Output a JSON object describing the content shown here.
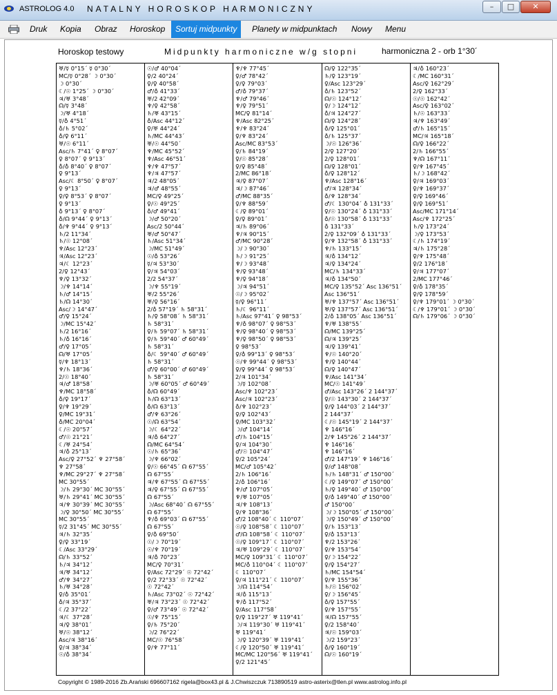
{
  "window": {
    "title": "ASTROLOG 4.0",
    "heading": "NATALNY HOROSKOP HARMONICZNY",
    "controls": {
      "minimize": "–",
      "maximize": "□",
      "close": "✕"
    }
  },
  "menu": [
    {
      "label": "Druk",
      "active": false
    },
    {
      "label": "Kopia",
      "active": false
    },
    {
      "label": "Obraz",
      "active": false
    },
    {
      "label": "Horoskop",
      "active": false
    },
    {
      "label": "Sortuj midpunkty",
      "active": true
    },
    {
      "label": "Planety w midpunktach",
      "active": false
    },
    {
      "label": "Nowy",
      "active": false
    },
    {
      "label": "Menu",
      "active": false
    }
  ],
  "header": {
    "chart_name": "Horoskop testowy",
    "title": "Midpunkty harmoniczne w/g stopni",
    "harmonic": "harmoniczna 2 - orb 1°30´"
  },
  "columns": [
    [
      "♅/☿ 0°15´ ☿ 0°30´",
      "MC/☿ 0°28´ ☽ 0°30´",
      "☽ 0°30´",
      "☾/☉ 1°25´ ☽ 0°30´",
      "♃/♅ 3°48´",
      "☊/☿ 3°48´",
      "☽/♅ 4°18´",
      "☿/♁ 4°51´",
      "♁/♄ 5°02´",
      "♁/♀ 6°11´",
      "♅/☉ 6°11´",
      "Asc/♄ 7°41´ ♀ 8°07´",
      "♀ 8°07´ ♀ 9°13´",
      "♁/♁ 8°40´ ♀ 8°07´",
      "♀ 9°13´",
      "Asc/☾ 8°50´ ♀ 8°07´",
      "♀ 9°13´",
      "♀/♀ 8°53´ ♀ 8°07´",
      "♀ 9°13´",
      "♁ 9°13´ ♀ 8°07´",
      "♁/☊ 9°44´ ♀ 9°13´",
      "♁/♆ 9°44´ ♀ 9°13´",
      "♄/2 11°34´",
      "♄/☉ 12°08´",
      "♆/Asc 12°23´",
      "♃/Asc 12°23´",
      "♃/☾ 12°23´",
      "2/♀ 12°43´",
      "♆/♀ 13°32´",
      "☽/♆ 14°14´",
      "♄/♂ 14°15´",
      "♄/☊ 14°30´",
      "Asc/☽ 14°47´",
      "♂/♀ 15°24´",
      "☽/MC 15°42´",
      "♄/2 16°16´",
      "♄/♁ 16°16´",
      "♂/♀ 17°05´",
      "☊/♅ 17°05´",
      "☿/♆ 18°13´",
      "♆/♄ 18°36´",
      "2/☉ 18°40´",
      "♃/♂ 18°58´",
      "♆/MC 18°58´",
      "♁/♀ 19°17´",
      "♀/♆ 19°29´",
      "♀/MC 19°31´",
      "♁/MC 20°04´",
      "☾/☉ 20°57´",
      "♂/☉ 21°21´",
      "☾/♅ 24°54´",
      "♃/♁ 25°13´",
      "Asc/♀ 27°52´ ♆ 27°58´",
      "♆ 27°58´",
      "♆/MC 29°27´ ♆ 27°58´",
      "MC 30°55´",
      "☽/♄ 29°30´ MC 30°55´",
      "♅/♄ 29°41´ MC 30°55´",
      "♃/♆ 30°39´ MC 30°55´",
      "☽/♀ 30°50´ MC 30°55´",
      "MC 30°55´",
      "☿/2 31°45´ MC 30°55´",
      "♃/♄ 32°35´",
      "♀/♀ 33°19´",
      "☾/Asc 33°29´",
      "☊/♄ 33°52´",
      "♄/♃ 34°12´",
      "♃/♅ 34°12´",
      "♂/♆ 34°27´",
      "♄/♅ 34°28´",
      "♀/♁ 35°01´",
      "♁/♃ 35°37´",
      "☾/2 37°22´",
      "♃/☾ 37°28´",
      "♃/♀ 38°01´",
      "♅/☉ 38°12´",
      "Asc/♃ 38°16´",
      "♀/♃ 38°34´",
      "☉/♁ 38°34´"
    ],
    [
      "☉/♂ 40°04´",
      "♀/2 40°24´",
      "♀/♀ 40°58´",
      "♂/♁ 41°33´",
      "♅/2 42°09´",
      "♆/♀ 42°58´",
      "♄/♅ 43°15´",
      "♁/Asc 44°12´",
      "♀/♅ 44°24´",
      "♄/MC 44°43´",
      "♅/☉ 44°50´",
      "♆/MC 45°52´",
      "♆/Asc 46°51´",
      "♆/♆ 47°57´",
      "♆/♃ 47°57´",
      "♃/2 48°05´",
      "♃/♂ 48°55´",
      "MC/♀ 49°25´",
      "♀/☉ 49°25´",
      "♁/♂ 49°41´",
      "☽/♂ 50°20´",
      "Asc/2 50°44´",
      "♅/♂ 50°47´",
      "♄/Asc 51°34´",
      "☽/MC 51°49´",
      "☉/♁ 53°26´",
      "☿/♃ 53°30´",
      "♀/♃ 54°03´",
      "2/2 54°37´",
      "☽/♆ 55°19´",
      "♅/2 55°26´",
      "♅/♀ 56°16´",
      "2/♁ 57°19´ ♄ 58°31´",
      "♄/♀ 58°08´ ♄ 58°31´",
      "♄ 58°31´",
      "♀/♄ 59°07´ ♄ 58°31´",
      "♀/♄ 59°40´ ♂ 60°49´",
      "♄ 58°31´",
      "♁/☾ 59°40´ ♂ 60°49´",
      "♄ 58°31´",
      "♂/♀ 60°00´ ♂ 60°49´",
      "♄ 58°31´",
      "☽/♅ 60°05´ ♂ 60°49´",
      "♁/☊ 60°49´",
      "♄/☊ 63°13´",
      "♁/☊ 63°13´",
      "♂/♆ 63°26´",
      "☉/☊ 63°54´",
      "☽/☾ 64°22´",
      "♃/♁ 64°27´",
      "☊/MC 64°54´",
      "☉/♄ 65°36´",
      "☽/♆ 66°02´",
      "♀/☉ 66°45´ ☊ 67°55´",
      "☊ 67°55´",
      "♃/♆ 67°55´ ☊ 67°55´",
      "♃/♀ 67°55´ ☊ 67°55´",
      "☊ 67°55´",
      "☽/Asc 68°40´ ☊ 67°55´",
      "☊ 67°55´",
      "♆/♁ 69°03´ ☊ 67°55´",
      "☊ 67°55´",
      "♀/♁ 69°50´",
      "☉/☽ 70°19´",
      "☉/♆ 70°19´",
      "♃/♁ 70°23´",
      "MC/♀ 70°31´",
      "♀/Asc 72°29´ ☉ 72°42´",
      "♀/2 72°33´ ☉ 72°42´",
      "☉ 72°42´",
      "♄/Asc 73°02´ ☉ 72°42´",
      "♅/♃ 73°23´ ☉ 72°42´",
      "♀/♂ 73°49´ ☉ 72°42´",
      "☉/♆ 75°15´",
      "♀/♄ 75°20´",
      "☽/2 76°22´",
      "MC/☉ 76°58´",
      "♀/♆ 77°11´"
    ],
    [
      "♆/♆ 77°45´",
      "♀/♂ 78°42´",
      "♀/♀ 79°03´",
      "♂/♁ 79°37´",
      "♆/♂ 79°46´",
      "♆/♀ 79°51´",
      "MC/♀ 81°14´",
      "♆/Asc 82°25´",
      "♆/♆ 83°24´",
      "♀/♆ 83°24´",
      "Asc/MC 83°53´",
      "♀/♄ 84°19´",
      "♀/☉ 85°28´",
      "♀/♀ 85°48´",
      "2/MC 86°18´",
      "♃/♀ 87°07´",
      "♃/☽ 87°46´",
      "♂/MC 88°35´",
      "♀/♆ 88°59´",
      "☾/♀ 89°01´",
      "♀/♀ 89°01´",
      "♃/♄ 89°06´",
      "♆/♃ 90°15´",
      "♂/MC 90°28´",
      "☽/☽ 90°30´",
      "♄/☽ 91°25´",
      "♆/☽ 93°48´",
      "♆/♀ 93°48´",
      "♆/♀ 94°18´",
      "☽/♃ 94°51´",
      "☉/☽ 95°02´",
      "☿/♀ 96°11´",
      "♄/☾ 96°11´",
      "♄/Asc 97°41´ ♀ 98°53´",
      "♆/♁ 98°07´ ♀ 98°53´",
      "♆/♀ 98°40´ ♀ 98°53´",
      "♆/♀ 98°50´ ♀ 98°53´",
      "♀ 98°53´",
      "♀/♁ 99°13´ ♀ 98°53´",
      "☉/♆ 99°44´ ♀ 98°53´",
      "♀/♀ 99°44´ ♀ 98°53´",
      "2/♃ 101°34´",
      "☽/☿ 102°08´",
      "Asc/♆ 102°23´",
      "Asc/♃ 102°23´",
      "♁/♆ 102°23´",
      "♀/♀ 102°43´",
      "♀/MC 103°32´",
      "☽/♂ 104°14´",
      "♂/♄ 104°15´",
      "♀/♃ 104°30´",
      "♂/☉ 104°47´",
      "♀/2 105°24´",
      "MC/♂ 105°42´",
      "2/♄ 106°16´",
      "2/♁ 106°16´",
      "♆/♂ 107°05´",
      "♆/♅ 107°05´",
      "♃/♆ 108°13´",
      "♀/♆ 108°36´",
      "♂/2 108°40´ ☾ 110°07´",
      "☉/♀ 108°58´ ☾ 110°07´",
      "♂/☊ 108°58´ ☾ 110°07´",
      "☉/♀ 109°17´ ☾ 110°07´",
      "♃/♅ 109°29´ ☾ 110°07´",
      "MC/♀ 109°31´ ☾ 110°07´",
      "MC/♁ 110°04´ ☾ 110°07´",
      "☾ 110°07´",
      "♀/♃ 111°21´ ☾ 110°07´",
      "☽/☊ 114°54´",
      "♃/♁ 115°13´",
      "♆/♁ 117°52´",
      "♀/Asc 117°58´",
      "♀/♀ 119°27´ ♅ 119°41´",
      "☽/♃ 119°30´ ♅ 119°41´",
      "♅ 119°41´",
      "☽/♀ 120°39´ ♅ 119°41´",
      "☾/♀ 120°50´ ♅ 119°41´",
      "MC/MC 120°56´ ♅ 119°41´",
      "♀/2 121°45´"
    ],
    [
      "☊/♀ 122°35´",
      "♄/♀ 123°19´",
      "♀/Asc 123°29´",
      "♁/♄ 123°52´",
      "☊/☉ 124°12´",
      "♀/☽ 124°12´",
      "♁/♃ 124°27´",
      "☊/♀ 124°28´",
      "♁/♀ 125°01´",
      "♁/♄ 125°37´",
      "☽/☉ 126°36´",
      "2/♀ 127°20´",
      "2/♀ 128°01´",
      "☊/♀ 128°01´",
      "♁/♀ 128°12´",
      "♆/Asc 128°16´",
      "♂/♃ 128°34´",
      "♁/♆ 128°34´",
      "♂/☾ 130°04´ ♁ 131°33´",
      "♀/☉ 130°24´ ♁ 131°33´",
      "♁/☉ 130°58´ ♁ 131°33´",
      "♁ 131°33´",
      "2/♀ 132°09´ ♁ 131°33´",
      "♀/♆ 132°58´ ♁ 131°33´",
      "♆/♄ 133°15´",
      "♃/♁ 134°12´",
      "♃/♀ 134°24´",
      "MC/♄ 134°33´",
      "♃/♁ 134°50´",
      "MC/♀ 135°52´ Asc 136°51´",
      "Asc 136°51´",
      "♅/♆ 137°57´ Asc 136°51´",
      "♅/♀ 137°57´ Asc 136°51´",
      "2/♁ 138°05´ Asc 136°51´",
      "♆/♅ 138°55´",
      "☊/MC 139°25´",
      "☊/♃ 139°25´",
      "♃/♀ 139°41´",
      "♆/☉ 140°20´",
      "♆/♀ 140°44´",
      "☊/♀ 140°47´",
      "♆/Asc 141°34´",
      "MC/☉ 141°49´",
      "♂/Asc 143°26´ 2 144°37´",
      "♀/☉ 143°30´ 2 144°37´",
      "♀/♀ 144°03´ 2 144°37´",
      "2 144°37´",
      "☾/☉ 145°19´ 2 144°37´",
      "♆ 146°16´",
      "2/♆ 145°26´ 2 144°37´",
      "♆ 146°16´",
      "♆ 146°16´",
      "♂/2 147°19´ ♆ 146°16´",
      "♀/♂ 148°08´",
      "♄/♄ 148°31´ ♂ 150°00´",
      "☾/♀ 149°07´ ♂ 150°00´",
      "♄/♀ 149°40´ ♂ 150°00´",
      "♀/♁ 149°40´ ♂ 150°00´",
      "♂ 150°00´",
      "☽/☽ 150°05´ ♂ 150°00´",
      "☽/♀ 150°49´ ♂ 150°00´",
      "♀/♄ 153°13´",
      "♀/♁ 153°13´",
      "♆/2 153°26´",
      "♀/♆ 153°54´",
      "♀/☽ 154°22´",
      "♀/♀ 154°27´",
      "♄/MC 154°54´",
      "♀/♆ 155°36´",
      "♄/☉ 156°02´",
      "♀/☽ 156°45´",
      "♁/♀ 157°55´",
      "♀/♆ 157°55´",
      "♃/☊ 157°55´",
      "♀/2 158°40´",
      "♃/☉ 159°03´",
      "☽/2 159°23´",
      "♁/♀ 160°19´",
      "☊/☉ 160°19´"
    ],
    [
      "♃/♁ 160°23´",
      "☾/MC 160°31´",
      "Asc/♀ 162°29´",
      "2/♀ 162°33´",
      "☉/☉ 162°42´",
      "Asc/♀ 163°02´",
      "♄/☉ 163°33´",
      "♃/♆ 163°49´",
      "♂/♄ 165°15´",
      "MC/♃ 165°18´",
      "☊/♀ 166°22´",
      "2/♄ 166°55´",
      "♆/☊ 167°11´",
      "♀/♆ 167°45´",
      "♄/☽ 168°42´",
      "♀/♃ 169°03´",
      "♀/♆ 169°37´",
      "♀/♀ 169°46´",
      "♀/♀ 169°51´",
      "Asc/MC 171°14´",
      "Asc/♆ 172°25´",
      "♄/♀ 173°24´",
      "☽/♀ 173°53´",
      "☾/♄ 174°19´",
      "♃/♄ 175°28´",
      "♀/♆ 175°48´",
      "♀/2 176°18´",
      "♀/♃ 177°07´",
      "2/MC 177°46´",
      "♀/♁ 178°35´",
      "♀/♀ 178°59´",
      "♀/♆ 179°01´ ☽ 0°30´",
      "☾/♆ 179°01´ ☽ 0°30´",
      "☊/♄ 179°06´ ☽ 0°30´"
    ]
  ],
  "footer": "Copyright © 1989-2016 Zb.Arański 696607162 rigela@box43.pl & J.Chwiszczuk 713890519 astro-asterix@tlen.pl www.astrolog.info.pl"
}
